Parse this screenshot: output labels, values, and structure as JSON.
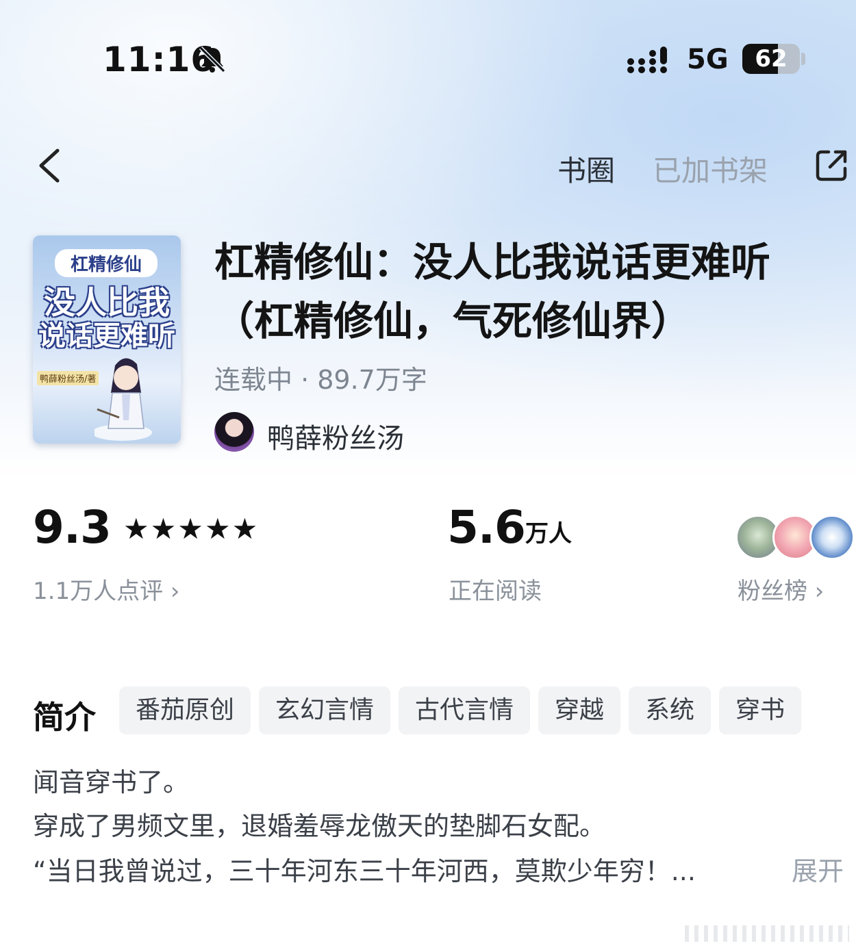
{
  "status_bar": {
    "time": "11:16",
    "network": "5G",
    "battery": "62"
  },
  "nav": {
    "circle": "书圈",
    "shelf": "已加书架"
  },
  "cover": {
    "line1": "杠精修仙",
    "line2": "没人比我",
    "line3": "说话更难听",
    "author_tag": "鸭薛粉丝汤/著"
  },
  "book": {
    "title": "杠精修仙：没人比我说话更难听（杠精修仙，气死修仙界）",
    "status_words": "连载中 · 89.7万字",
    "author": "鸭薛粉丝汤"
  },
  "stats": {
    "rating": "9.3",
    "stars": "★★★★★",
    "rating_count": "1.1万人点评 ›",
    "readers": "5.6",
    "readers_unit": "万人",
    "readers_label": "正在阅读",
    "fans_label": "粉丝榜 ›"
  },
  "intro": {
    "heading": "简介",
    "tags": [
      "番茄原创",
      "玄幻言情",
      "古代言情",
      "穿越",
      "系统",
      "穿书"
    ],
    "lines": [
      "闻音穿书了。",
      "穿成了男频文里，退婚羞辱龙傲天的垫脚石女配。",
      "“当日我曾说过，三十年河东三十年河西，莫欺少年穷！..."
    ],
    "expand": "展开"
  },
  "colors": {
    "accent": "#2a2f36",
    "muted": "#8a919a",
    "tag_bg": "#f2f3f5"
  }
}
